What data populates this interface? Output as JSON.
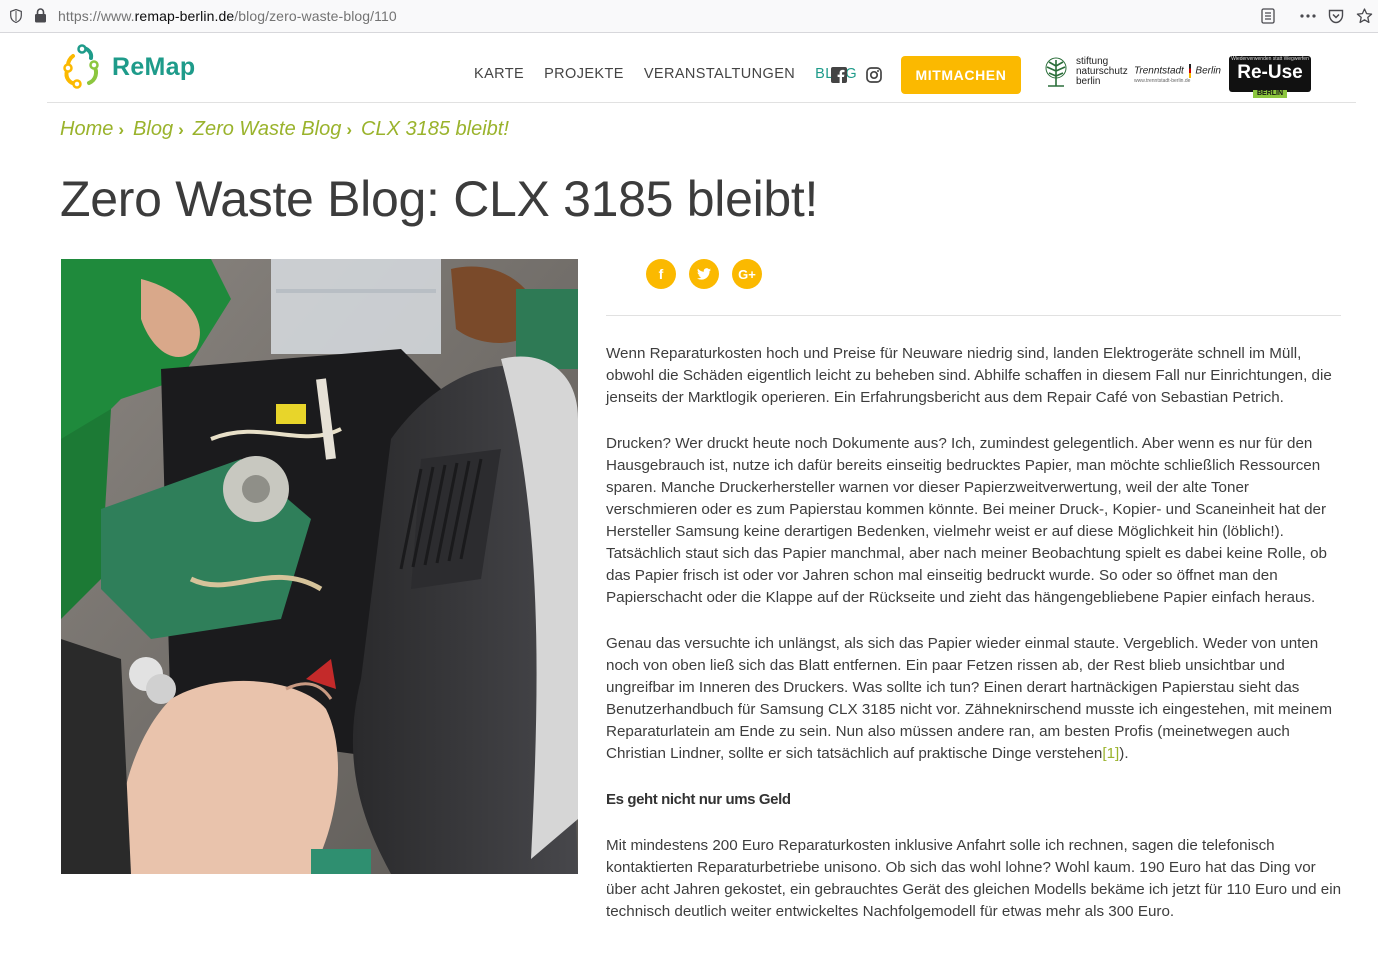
{
  "browser": {
    "url_prefix": "https://www.",
    "url_domain": "remap-berlin.de",
    "url_path": "/blog/zero-waste-blog/110"
  },
  "logo": {
    "text": "ReMap"
  },
  "nav": {
    "items": [
      {
        "label": "KARTE"
      },
      {
        "label": "PROJEKTE"
      },
      {
        "label": "VERANSTALTUNGEN"
      },
      {
        "label": "BLOG"
      }
    ],
    "cta": "MITMACHEN"
  },
  "partners": {
    "stiftung": [
      "stiftung",
      "naturschutz",
      "berlin"
    ],
    "trenn": "Trenntstadt",
    "trenn_city": "Berlin",
    "trenn_small": "www.trenntstadt-berlin.de",
    "reuse_top": "Wiederverwenden statt Wegwerfen",
    "reuse_main": "Re-Use",
    "reuse_sub": "BERLIN"
  },
  "breadcrumb": {
    "home": "Home",
    "blog": "Blog",
    "category": "Zero Waste Blog",
    "current": "CLX 3185 bleibt!"
  },
  "page": {
    "title": "Zero Waste Blog: CLX 3185 bleibt!"
  },
  "article": {
    "p1": "Wenn Reparaturkosten hoch und Preise für Neuware niedrig sind, landen Elektrogeräte schnell im Müll, obwohl die Schäden eigentlich leicht zu beheben sind. Abhilfe schaffen in diesem Fall nur Einrichtungen, die jenseits der Marktlogik operieren. Ein Erfahrungsbericht aus dem Repair Café von Sebastian Petrich.",
    "p2": "Drucken? Wer druckt heute noch Dokumente aus? Ich, zumindest gelegentlich. Aber wenn es nur für den Hausgebrauch ist, nutze ich dafür bereits einseitig bedrucktes Papier, man möchte schließlich Ressourcen sparen. Manche Druckerhersteller warnen vor dieser Papierzweitverwertung, weil der alte Toner verschmieren oder es zum Papierstau kommen könnte. Bei meiner Druck-, Kopier- und Scaneinheit hat der Hersteller Samsung keine derartigen Bedenken, vielmehr weist er auf diese Möglichkeit hin (löblich!). Tatsächlich staut sich das Papier manchmal, aber nach meiner Beobachtung spielt es dabei keine Rolle, ob das Papier frisch ist oder vor Jahren schon mal einseitig bedruckt wurde. So oder so öffnet man den Papierschacht oder die Klappe auf der Rückseite und zieht das hängengebliebene Papier einfach heraus.",
    "p3": "Genau das versuchte ich unlängst, als sich das Papier wieder einmal staute. Vergeblich. Weder von unten noch von oben ließ sich das Blatt entfernen. Ein paar Fetzen rissen ab, der Rest blieb unsichtbar und ungreifbar im Inneren des Druckers. Was sollte ich tun? Einen derart hartnäckigen Papierstau sieht das Benutzerhandbuch für Samsung CLX 3185 nicht vor. Zähneknirschend musste ich eingestehen, mit meinem Reparaturlatein am Ende zu sein. Nun also müssen andere ran, am besten Profis (meinetwegen auch Christian Lindner, sollte er sich tatsächlich auf praktische Dinge verstehen",
    "p3_footnote": "[1]",
    "p3_end": ").",
    "heading": "Es geht nicht nur ums Geld",
    "p4": "Mit mindestens 200 Euro Reparaturkosten inklusive Anfahrt solle ich rechnen, sagen die telefonisch kontaktierten Reparaturbetriebe unisono. Ob sich das wohl lohne? Wohl kaum. 190 Euro hat das Ding vor über acht Jahren gekostet, ein gebrauchtes Gerät des gleichen Modells bekäme ich jetzt für 110 Euro und ein technisch deutlich weiter entwickeltes Nachfolgemodell für etwas mehr als 300 Euro."
  },
  "colors": {
    "accent_teal": "#1e9b8a",
    "accent_yellow": "#fbb900",
    "accent_green": "#9ab32c"
  }
}
